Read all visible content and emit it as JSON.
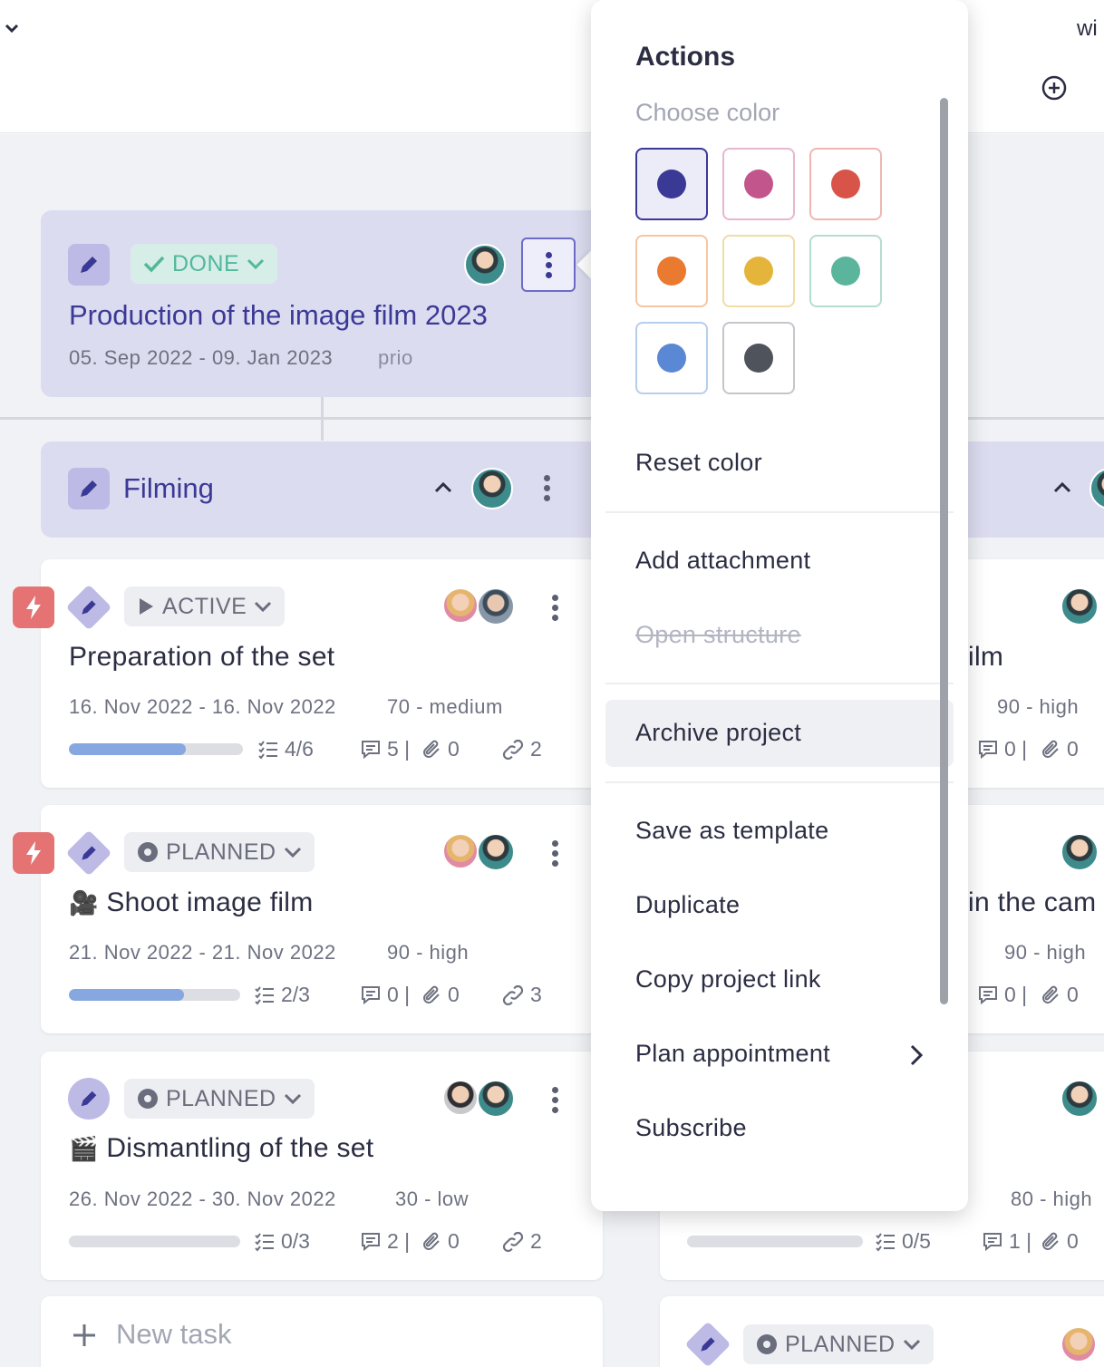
{
  "topbar": {
    "partial_label": "wi"
  },
  "project": {
    "status": "DONE",
    "title": "Production of the image film 2023",
    "dates": "05. Sep 2022 - 09. Jan 2023",
    "prio": "prio"
  },
  "group": {
    "title": "Filming"
  },
  "tasks": [
    {
      "status": "ACTIVE",
      "title": "Preparation of the set",
      "dates": "16. Nov 2022 - 16. Nov 2022",
      "priority": "70 - medium",
      "checklist": "4/6",
      "comments": "5 |",
      "attachments": "0",
      "links": "2",
      "progress": 0.67
    },
    {
      "status": "PLANNED",
      "emoji": "🎥",
      "title": "Shoot image film",
      "dates": "21. Nov 2022 - 21. Nov 2022",
      "priority": "90 - high",
      "checklist": "2/3",
      "comments": "0 |",
      "attachments": "0",
      "links": "3",
      "progress": 0.67
    },
    {
      "status": "PLANNED",
      "emoji": "🎬",
      "title": "Dismantling of the set",
      "dates": "26. Nov 2022 - 30. Nov 2022",
      "priority": "30 - low",
      "checklist": "0/3",
      "comments": "2 |",
      "attachments": "0",
      "links": "2",
      "progress": 0
    }
  ],
  "new_task": "New task",
  "right_column": {
    "task1_title_fragment": "ilm",
    "task1_priority": "90 - high",
    "task1_comments": "0 |",
    "task1_attachments": "0",
    "task2_title_fragment": "in the cam",
    "task2_priority": "90 - high",
    "task2_comments": "0 |",
    "task2_attachments": "0",
    "task3_priority": "80 - high",
    "task3_checklist": "0/5",
    "task3_comments": "1 |",
    "task3_attachments": "0",
    "task4_status": "PLANNED"
  },
  "menu": {
    "heading": "Actions",
    "choose_color": "Choose color",
    "colors": [
      "#3b3996",
      "#c2568c",
      "#d95448",
      "#ea7a30",
      "#e5b43a",
      "#5bb59c",
      "#5b88d4",
      "#4f545c"
    ],
    "reset_color": "Reset color",
    "add_attachment": "Add attachment",
    "open_structure": "Open structure",
    "archive_project": "Archive project",
    "save_as_template": "Save as template",
    "duplicate": "Duplicate",
    "copy_project_link": "Copy project link",
    "plan_appointment": "Plan appointment",
    "subscribe": "Subscribe"
  }
}
